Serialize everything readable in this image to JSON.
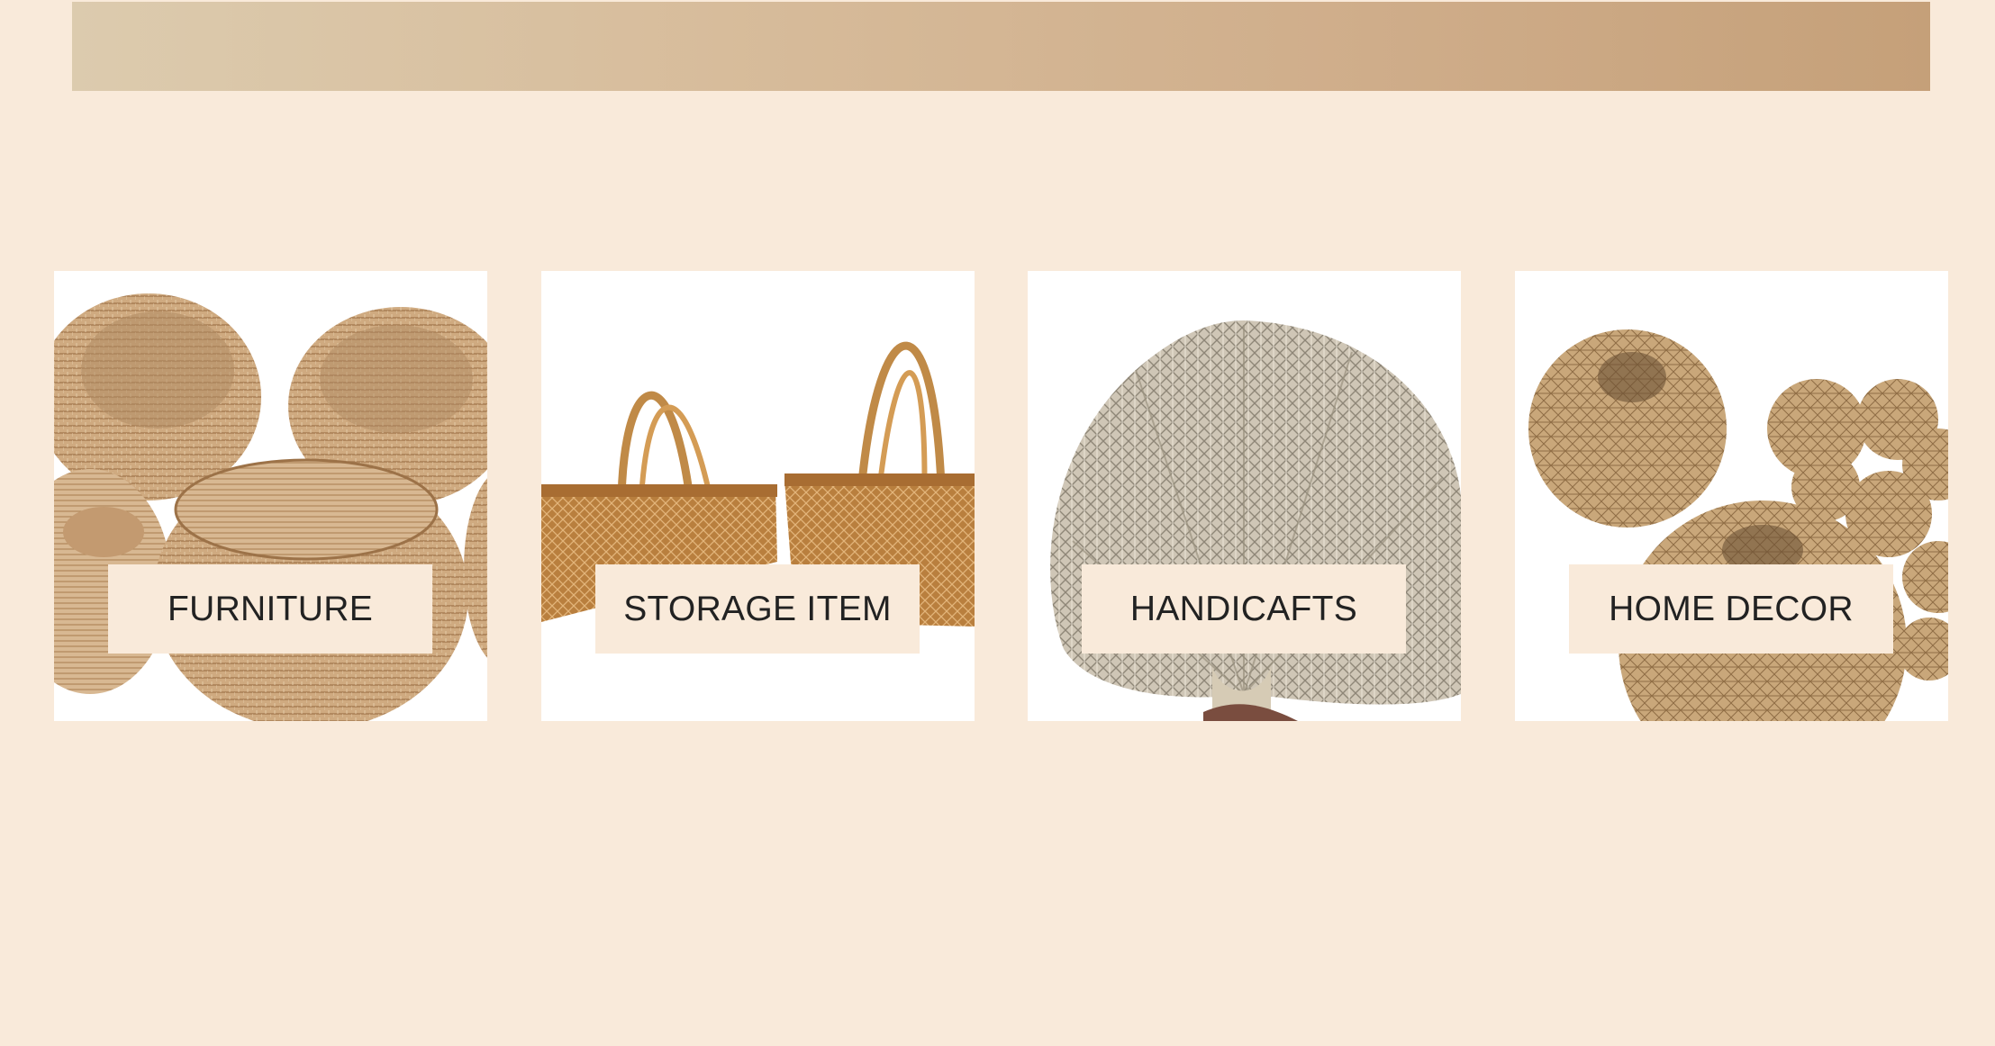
{
  "categories": [
    {
      "label": "FURNITURE",
      "image": "wicker-chairs-image"
    },
    {
      "label": "STORAGE ITEM",
      "image": "woven-baskets-image"
    },
    {
      "label": "HANDICAFTS",
      "image": "woven-fan-image"
    },
    {
      "label": "HOME DECOR",
      "image": "rattan-lamps-image"
    }
  ],
  "colors": {
    "page_background": "#f9eada",
    "card_background": "#ffffff",
    "label_text": "#222222",
    "banner_start": "#dccbae",
    "banner_end": "#c5a079"
  }
}
